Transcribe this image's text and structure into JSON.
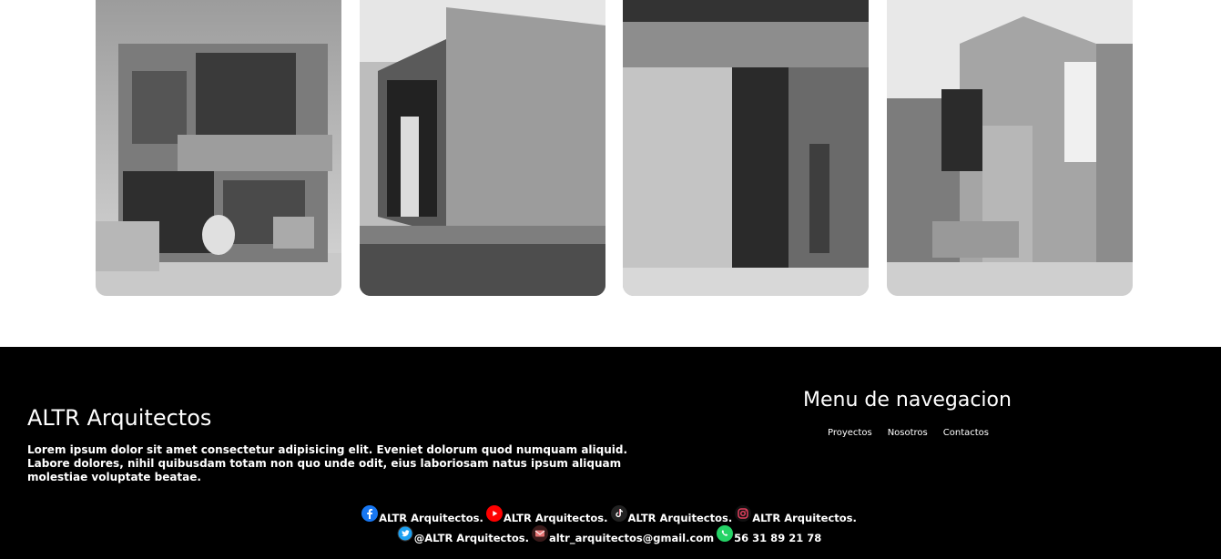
{
  "gallery": {
    "images": [
      {
        "alt": "building-under-construction-photo"
      },
      {
        "alt": "concrete-house-photo"
      },
      {
        "alt": "block-wall-doorway-photo"
      },
      {
        "alt": "modern-facade-photo"
      }
    ]
  },
  "footer": {
    "brand": "ALTR Arquitectos",
    "description": "Lorem ipsum dolor sit amet consectetur adipisicing elit. Eveniet dolorum quod numquam aliquid. Labore dolores, nihil quibusdam totam non quo unde odit, eius laboriosam natus ipsum aliquam molestiae voluptate beatae.",
    "menu_title": "Menu de navegacion",
    "menu": [
      "Proyectos",
      "Nosotros",
      "Contactos"
    ],
    "social": {
      "facebook": "ALTR Arquitectos.",
      "youtube": "ALTR Arquitectos.",
      "tiktok": "ALTR Arquitectos.",
      "instagram": "ALTR Arquitectos.",
      "twitter": "@ALTR Arquitectos.",
      "email": "altr_arquitectos@gmail.com",
      "whatsapp": "56 31 89 21 78"
    }
  },
  "colors": {
    "footer_bg": "#000000",
    "facebook": "#1877f2",
    "youtube": "#ff0000",
    "tiktok": "#222222",
    "instagram": "#e4405f",
    "twitter": "#1da1f2",
    "email": "#e57373",
    "whatsapp": "#25d366"
  }
}
